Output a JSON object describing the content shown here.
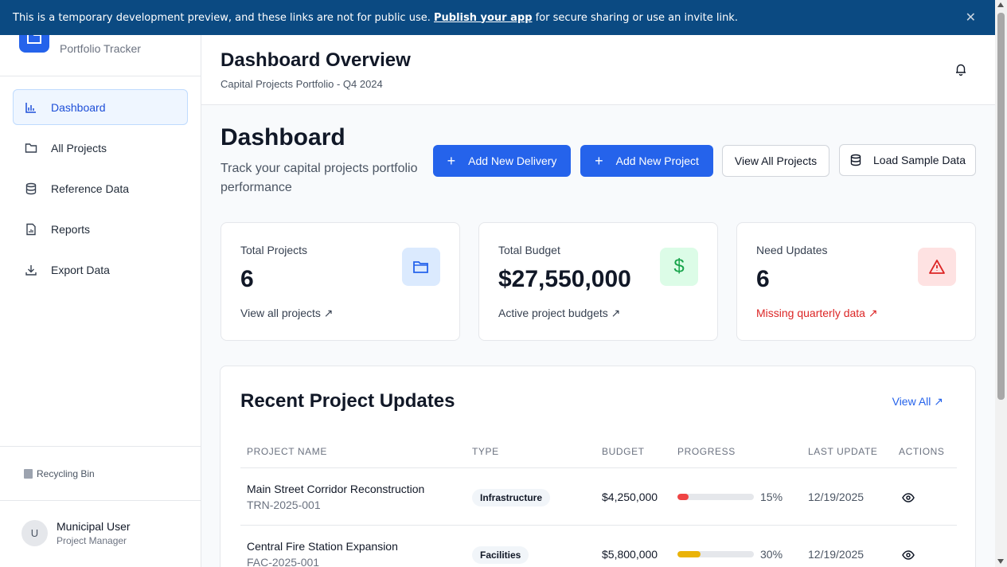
{
  "banner": {
    "text_before": "This is a temporary development preview, and these links are not for public use.",
    "link": "Publish your app",
    "text_after": "for secure sharing or use an invite link.",
    "close": "✕"
  },
  "sidebar": {
    "subtitle": "Portfolio Tracker",
    "items": [
      {
        "label": "Dashboard",
        "icon": "bar-chart-icon"
      },
      {
        "label": "All Projects",
        "icon": "folder-icon"
      },
      {
        "label": "Reference Data",
        "icon": "database-icon"
      },
      {
        "label": "Reports",
        "icon": "report-icon"
      },
      {
        "label": "Export Data",
        "icon": "download-icon"
      }
    ],
    "recycle": "Recycling Bin",
    "user": {
      "initial": "U",
      "name": "Municipal User",
      "role": "Project Manager"
    }
  },
  "header": {
    "title": "Dashboard Overview",
    "subtitle": "Capital Projects Portfolio - Q4 2024"
  },
  "main": {
    "title": "Dashboard",
    "description": "Track your capital projects portfolio performance",
    "buttons": {
      "add_delivery": "Add New Delivery",
      "add_project": "Add New Project",
      "view_all": "View All Projects",
      "load_sample": "Load Sample Data"
    }
  },
  "cards": [
    {
      "label": "Total Projects",
      "value": "6",
      "link": "View all projects ↗",
      "color": "#2563eb"
    },
    {
      "label": "Total Budget",
      "value": "$27,550,000",
      "link": "Active project budgets ↗",
      "color": "#16a34a"
    },
    {
      "label": "Need Updates",
      "value": "6",
      "link": "Missing quarterly data ↗",
      "color": "#dc2626"
    }
  ],
  "updates": {
    "title": "Recent Project Updates",
    "view_all": "View All ↗",
    "columns": [
      "PROJECT NAME",
      "TYPE",
      "BUDGET",
      "PROGRESS",
      "LAST UPDATE",
      "ACTIONS"
    ],
    "rows": [
      {
        "name": "Main Street Corridor Reconstruction",
        "code": "TRN-2025-001",
        "type": "Infrastructure",
        "budget": "$4,250,000",
        "progress": 15,
        "progress_label": "15%",
        "progress_color": "#ef4444",
        "updated": "12/19/2025"
      },
      {
        "name": "Central Fire Station Expansion",
        "code": "FAC-2025-001",
        "type": "Facilities",
        "budget": "$5,800,000",
        "progress": 30,
        "progress_label": "30%",
        "progress_color": "#eab308",
        "updated": "12/19/2025"
      }
    ]
  }
}
